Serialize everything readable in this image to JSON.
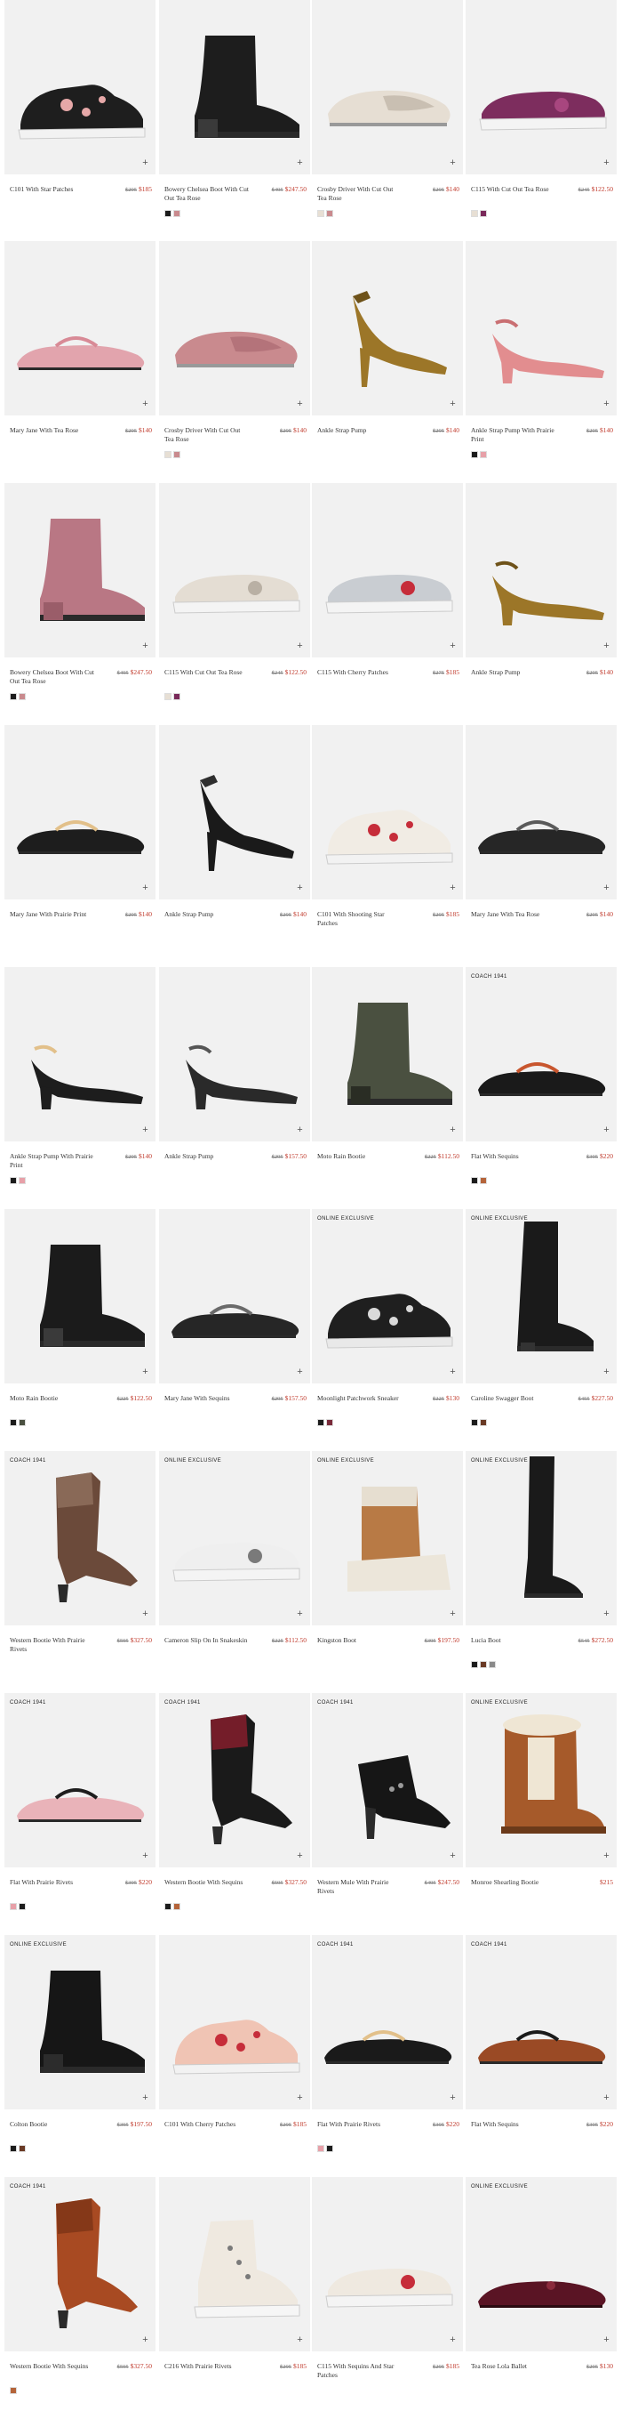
{
  "products": [
    {
      "name": "C101 With Star Patches",
      "was": "$295",
      "price": "$185",
      "badge": "",
      "swatches": [],
      "shoe": {
        "type": "sneaker",
        "color": "#1e1e1e",
        "accent": "#e6a8a8"
      }
    },
    {
      "name": "Bowery Chelsea Boot With Cut Out Tea Rose",
      "was": "$495",
      "price": "$247.50",
      "badge": "",
      "swatches": [
        "#1c1c1c",
        "#c98a8e"
      ],
      "shoe": {
        "type": "boot",
        "color": "#1d1d1d",
        "accent": "#3a3a3a"
      }
    },
    {
      "name": "Crosby Driver With Cut Out Tea Rose",
      "was": "$295",
      "price": "$140",
      "badge": "",
      "swatches": [
        "#e7dfd4",
        "#c98a8e"
      ],
      "shoe": {
        "type": "loafer",
        "color": "#e6ded3",
        "accent": "#c9bfb2"
      }
    },
    {
      "name": "C115 With Cut Out Tea Rose",
      "was": "$245",
      "price": "$122.50",
      "badge": "",
      "swatches": [
        "#e7dfd4",
        "#7a2a5a"
      ],
      "shoe": {
        "type": "slipon",
        "color": "#7d2d5e",
        "accent": "#a8467f"
      }
    },
    {
      "name": "Mary Jane With Tea Rose",
      "was": "$295",
      "price": "$140",
      "badge": "",
      "swatches": [],
      "shoe": {
        "type": "flat",
        "color": "#e2a4ad",
        "accent": "#d88a96"
      }
    },
    {
      "name": "Crosby Driver With Cut Out Tea Rose",
      "was": "$295",
      "price": "$140",
      "badge": "",
      "swatches": [
        "#e7dfd4",
        "#c98a8e"
      ],
      "shoe": {
        "type": "loafer",
        "color": "#c98a8e",
        "accent": "#b4737a"
      }
    },
    {
      "name": "Ankle Strap Pump",
      "was": "$295",
      "price": "$140",
      "badge": "",
      "swatches": [],
      "shoe": {
        "type": "pump",
        "color": "#9c7628",
        "accent": "#6e5219"
      }
    },
    {
      "name": "Ankle Strap Pump With Prairie Print",
      "was": "$295",
      "price": "$140",
      "badge": "",
      "swatches": [
        "#1c1c1c",
        "#e7a0a8"
      ],
      "shoe": {
        "type": "lowpump",
        "color": "#e28d8f",
        "accent": "#c96f72"
      }
    },
    {
      "name": "Bowery Chelsea Boot With Cut Out Tea Rose",
      "was": "$495",
      "price": "$247.50",
      "badge": "",
      "swatches": [
        "#1c1c1c",
        "#c98a8e"
      ],
      "shoe": {
        "type": "boot",
        "color": "#b97784",
        "accent": "#9a5d69"
      }
    },
    {
      "name": "C115 With Cut Out Tea Rose",
      "was": "$245",
      "price": "$122.50",
      "badge": "",
      "swatches": [
        "#e7dfd4",
        "#7a2a5a"
      ],
      "shoe": {
        "type": "slipon",
        "color": "#e4ddd3",
        "accent": "#b9b0a4"
      }
    },
    {
      "name": "C115 With Cherry Patches",
      "was": "$275",
      "price": "$185",
      "badge": "",
      "swatches": [],
      "shoe": {
        "type": "slipon",
        "color": "#c9cdd2",
        "accent": "#c62d3a"
      }
    },
    {
      "name": "Ankle Strap Pump",
      "was": "$295",
      "price": "$140",
      "badge": "",
      "swatches": [],
      "shoe": {
        "type": "lowpump",
        "color": "#9c7628",
        "accent": "#6e5219"
      }
    },
    {
      "name": "Mary Jane With Prairie Print",
      "was": "$295",
      "price": "$140",
      "badge": "",
      "swatches": [],
      "shoe": {
        "type": "flat",
        "color": "#1d1d1d",
        "accent": "#e2c08a"
      }
    },
    {
      "name": "Ankle Strap Pump",
      "was": "$295",
      "price": "$140",
      "badge": "",
      "swatches": [],
      "shoe": {
        "type": "pump",
        "color": "#1a1a1a",
        "accent": "#2e2e2e"
      }
    },
    {
      "name": "C101 With Shooting Star Patches",
      "was": "$295",
      "price": "$185",
      "badge": "",
      "swatches": [],
      "shoe": {
        "type": "sneaker",
        "color": "#f1ece4",
        "accent": "#c62d3a"
      }
    },
    {
      "name": "Mary Jane With Tea Rose",
      "was": "$295",
      "price": "$140",
      "badge": "",
      "swatches": [],
      "shoe": {
        "type": "flat",
        "color": "#262626",
        "accent": "#5a5a5a"
      }
    },
    {
      "name": "Ankle Strap Pump With Prairie Print",
      "was": "$295",
      "price": "$140",
      "badge": "",
      "swatches": [
        "#1c1c1c",
        "#e7a0a8"
      ],
      "shoe": {
        "type": "lowpump",
        "color": "#1d1d1d",
        "accent": "#e2c08a"
      }
    },
    {
      "name": "Ankle Strap Pump",
      "was": "$295",
      "price": "$157.50",
      "badge": "",
      "swatches": [],
      "shoe": {
        "type": "lowpump",
        "color": "#2a2a2a",
        "accent": "#555555"
      }
    },
    {
      "name": "Moto Rain Bootie",
      "was": "$225",
      "price": "$112.50",
      "badge": "",
      "swatches": [],
      "shoe": {
        "type": "boot",
        "color": "#4a5040",
        "accent": "#2a2d24"
      }
    },
    {
      "name": "Flat With Sequins",
      "was": "$395",
      "price": "$220",
      "badge": "COACH 1941",
      "swatches": [
        "#1c1c1c",
        "#b5643a"
      ],
      "shoe": {
        "type": "flat",
        "color": "#1a1a1a",
        "accent": "#c8562e"
      }
    },
    {
      "name": "Moto Rain Bootie",
      "was": "$225",
      "price": "$122.50",
      "badge": "",
      "swatches": [
        "#1c1c1c",
        "#4a5040"
      ],
      "shoe": {
        "type": "boot",
        "color": "#1b1b1b",
        "accent": "#3a3a3a"
      }
    },
    {
      "name": "Mary Jane With Sequins",
      "was": "$295",
      "price": "$157.50",
      "badge": "",
      "swatches": [],
      "shoe": {
        "type": "flat",
        "color": "#262626",
        "accent": "#6a6a6a"
      }
    },
    {
      "name": "Moonlight Patchwork Sneaker",
      "was": "$225",
      "price": "$130",
      "badge": "ONLINE EXCLUSIVE",
      "swatches": [
        "#1c1c1c",
        "#7a2a3a"
      ],
      "shoe": {
        "type": "sneaker",
        "color": "#1f1f1f",
        "accent": "#d9d9d9"
      }
    },
    {
      "name": "Caroline Swagger Boot",
      "was": "$455",
      "price": "$227.50",
      "badge": "ONLINE EXCLUSIVE",
      "swatches": [
        "#1c1c1c",
        "#6a3a25"
      ],
      "shoe": {
        "type": "tallboot",
        "color": "#1a1a1a",
        "accent": "#333333"
      }
    },
    {
      "name": "Western Bootie With Prairie Rivets",
      "was": "$595",
      "price": "$327.50",
      "badge": "COACH 1941",
      "swatches": [],
      "shoe": {
        "type": "western",
        "color": "#6b4a3a",
        "accent": "#9c7f6a"
      }
    },
    {
      "name": "Cameron Slip On In Snakeskin",
      "was": "$225",
      "price": "$112.50",
      "badge": "ONLINE EXCLUSIVE",
      "swatches": [],
      "shoe": {
        "type": "slipon",
        "color": "#efefef",
        "accent": "#7a7a7a"
      }
    },
    {
      "name": "Kingston Boot",
      "was": "$395",
      "price": "$197.50",
      "badge": "ONLINE EXCLUSIVE",
      "swatches": [],
      "shoe": {
        "type": "wedgeboot",
        "color": "#b87a45",
        "accent": "#e6ded0"
      }
    },
    {
      "name": "Lucia Boot",
      "was": "$545",
      "price": "$272.50",
      "badge": "ONLINE EXCLUSIVE",
      "swatches": [
        "#1c1c1c",
        "#6a3a25",
        "#8a8a8a"
      ],
      "shoe": {
        "type": "otk",
        "color": "#1a1a1a",
        "accent": "#333333"
      }
    },
    {
      "name": "Flat With Prairie Rivets",
      "was": "$395",
      "price": "$220",
      "badge": "COACH 1941",
      "swatches": [
        "#e7a0a8",
        "#1c1c1c"
      ],
      "shoe": {
        "type": "flat",
        "color": "#e9b3b9",
        "accent": "#1d1d1d"
      }
    },
    {
      "name": "Western Bootie With Sequins",
      "was": "$595",
      "price": "$327.50",
      "badge": "COACH 1941",
      "swatches": [
        "#1c1c1c",
        "#b5643a"
      ],
      "shoe": {
        "type": "western",
        "color": "#1a1a1a",
        "accent": "#b02033"
      }
    },
    {
      "name": "Western Mule With Prairie Rivets",
      "was": "$495",
      "price": "$247.50",
      "badge": "COACH 1941",
      "swatches": [],
      "shoe": {
        "type": "mule",
        "color": "#161616",
        "accent": "#9a9a9a"
      }
    },
    {
      "name": "Monroe Shearling Bootie",
      "was": "",
      "price": "$215",
      "badge": "ONLINE EXCLUSIVE",
      "swatches": [],
      "shoe": {
        "type": "shearling",
        "color": "#a65a2a",
        "accent": "#efe6d4"
      }
    },
    {
      "name": "Colton Bootie",
      "was": "$395",
      "price": "$197.50",
      "badge": "ONLINE EXCLUSIVE",
      "swatches": [
        "#1c1c1c",
        "#6a3a25"
      ],
      "shoe": {
        "type": "boot",
        "color": "#161616",
        "accent": "#2c2c2c"
      }
    },
    {
      "name": "C101 With Cherry Patches",
      "was": "$295",
      "price": "$185",
      "badge": "",
      "swatches": [],
      "shoe": {
        "type": "sneaker",
        "color": "#f0c4b4",
        "accent": "#c62d3a"
      }
    },
    {
      "name": "Flat With Prairie Rivets",
      "was": "$395",
      "price": "$220",
      "badge": "COACH 1941",
      "swatches": [
        "#e7a0a8",
        "#1c1c1c"
      ],
      "shoe": {
        "type": "flat",
        "color": "#1a1a1a",
        "accent": "#e2c08a"
      }
    },
    {
      "name": "Flat With Sequins",
      "was": "$395",
      "price": "$220",
      "badge": "COACH 1941",
      "swatches": [],
      "shoe": {
        "type": "flat",
        "color": "#9a4a25",
        "accent": "#1a1a1a"
      }
    },
    {
      "name": "Western Bootie With Sequins",
      "was": "$595",
      "price": "$327.50",
      "badge": "COACH 1941",
      "swatches": [
        "#b5643a"
      ],
      "shoe": {
        "type": "western",
        "color": "#a84a22",
        "accent": "#6e2d12"
      }
    },
    {
      "name": "C216 With Prairie Rivets",
      "was": "$295",
      "price": "$185",
      "badge": "",
      "swatches": [],
      "shoe": {
        "type": "hightop",
        "color": "#efe9e0",
        "accent": "#7a7a7a"
      }
    },
    {
      "name": "C115 With Sequins And Star Patches",
      "was": "$295",
      "price": "$185",
      "badge": "",
      "swatches": [],
      "shoe": {
        "type": "slipon",
        "color": "#efe9e0",
        "accent": "#c62d3a"
      }
    },
    {
      "name": "Tea Rose Lola Ballet",
      "was": "$295",
      "price": "$130",
      "badge": "ONLINE EXCLUSIVE",
      "swatches": [],
      "shoe": {
        "type": "ballet",
        "color": "#5a1424",
        "accent": "#8a2a3c"
      }
    }
  ]
}
